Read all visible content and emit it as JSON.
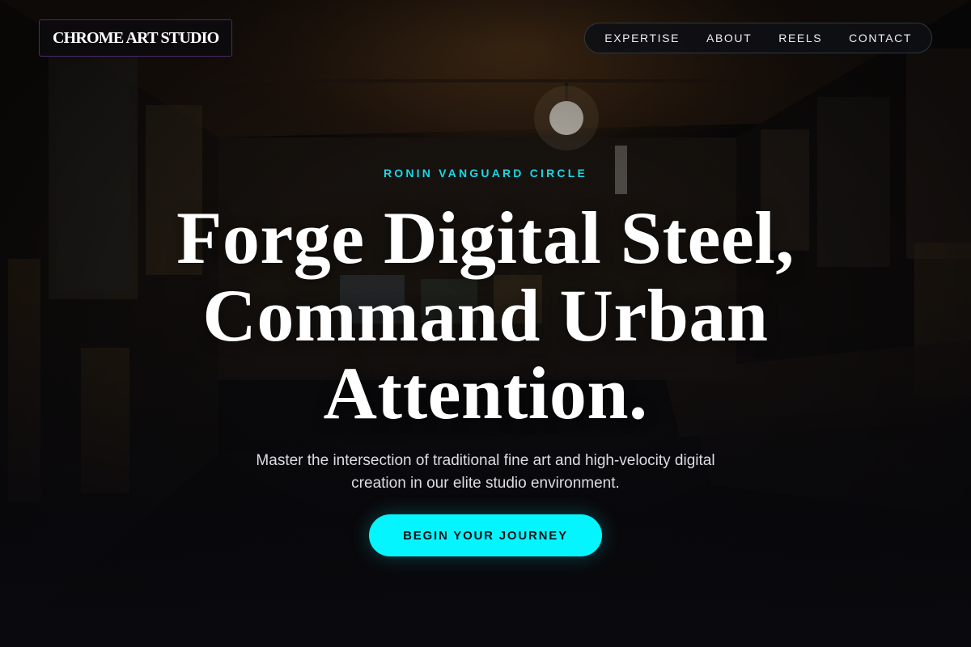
{
  "header": {
    "logo": "CHROME ART STUDIO",
    "nav": [
      {
        "label": "EXPERTISE"
      },
      {
        "label": "ABOUT"
      },
      {
        "label": "REELS"
      },
      {
        "label": "CONTACT"
      }
    ]
  },
  "hero": {
    "eyebrow": "RONIN VANGUARD CIRCLE",
    "headline_lines": [
      "Forge Digital Steel,",
      "Command Urban",
      "Attention."
    ],
    "subtext_lines": [
      "Master the intersection of traditional fine art and high-velocity digital",
      "creation in our elite studio environment."
    ],
    "cta_label": "BEGIN YOUR JOURNEY"
  },
  "colors": {
    "accent": "#05f5ff",
    "eyebrow": "#18d8e6",
    "logo_border": "#4b2a6a",
    "background": "#0b0a0c"
  },
  "icons": [
    "background-gallery-image"
  ]
}
